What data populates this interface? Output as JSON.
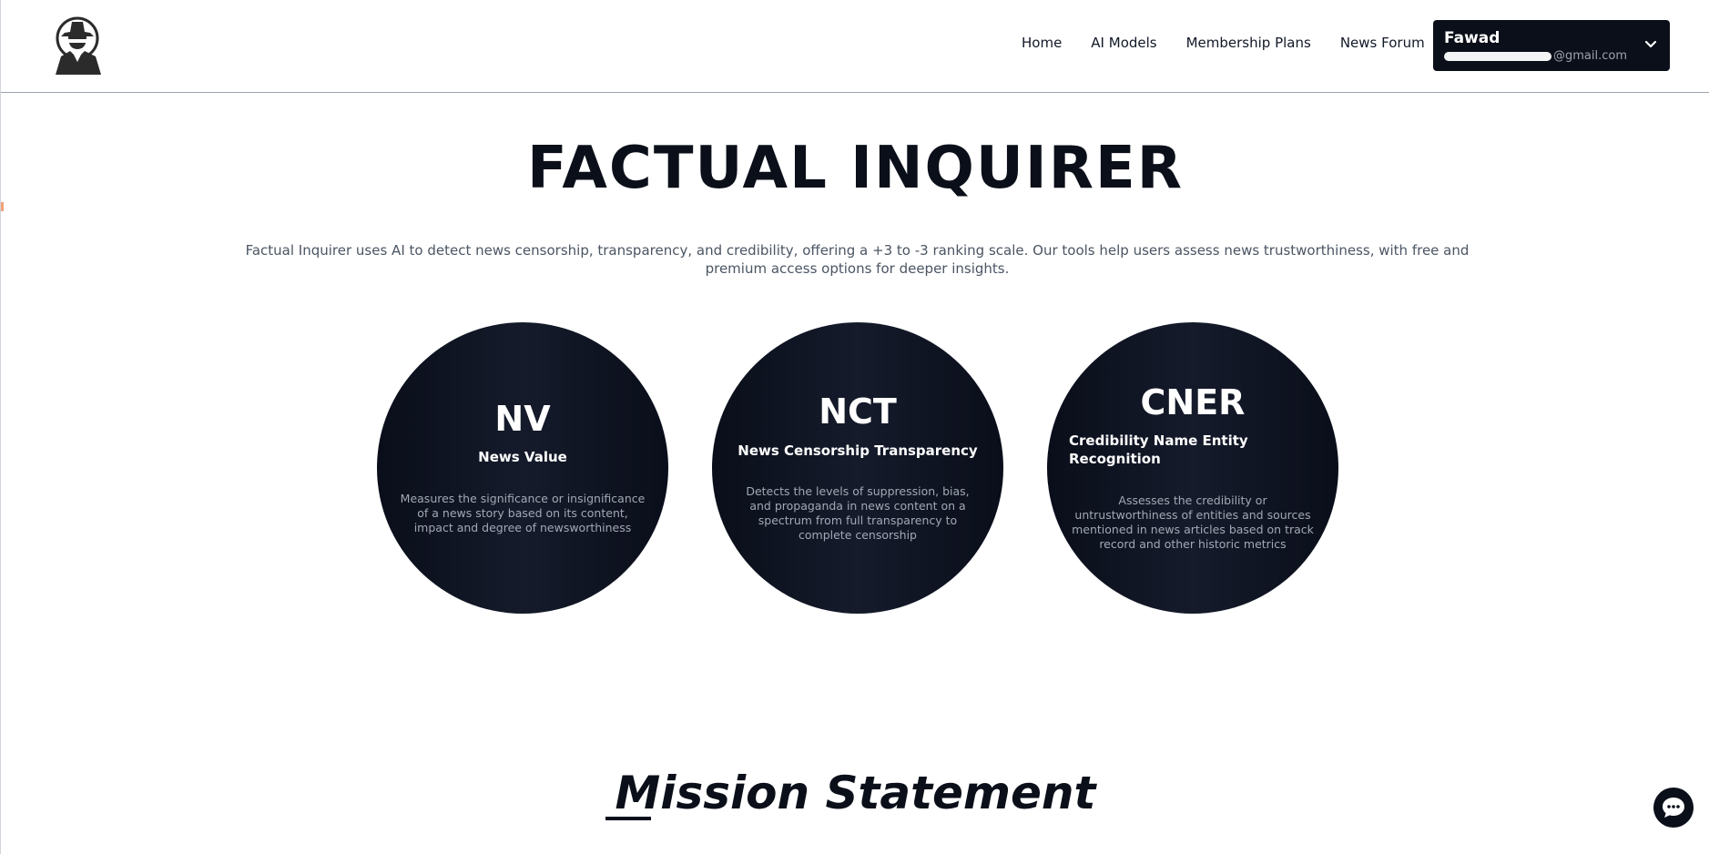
{
  "header": {
    "nav": [
      "Home",
      "AI Models",
      "Membership Plans",
      "News Forum"
    ],
    "user": {
      "name": "Fawad",
      "email_suffix": "@gmail.com"
    }
  },
  "hero": {
    "title": "FACTUAL INQUIRER",
    "description": "Factual Inquirer uses AI to detect news censorship, transparency, and credibility, offering a +3 to -3 ranking scale. Our tools help users assess news trustworthiness, with free and premium access options for deeper insights."
  },
  "models": [
    {
      "abbr": "NV",
      "name": "News Value",
      "description": "Measures the significance or insignificance of a news story based on its content, impact and degree of newsworthiness"
    },
    {
      "abbr": "NCT",
      "name": "News Censorship Transparency",
      "description": "Detects the levels of suppression, bias, and propaganda in news content on a spectrum from full transparency to complete censorship"
    },
    {
      "abbr": "CNER",
      "name": "Credibility Name Entity Recognition",
      "description": "Assesses the credibility or untrustworthiness of entities and sources mentioned in news articles based on track record and other historic metrics"
    }
  ],
  "mission": {
    "title": "Mission Statement"
  },
  "icons": {
    "logo": "detective-logo-icon",
    "user_menu": "chevron-down-icon",
    "chat": "chat-bubble-icon"
  },
  "colors": {
    "primary_dark": "#0b0f19",
    "text_muted": "#4b5563"
  }
}
